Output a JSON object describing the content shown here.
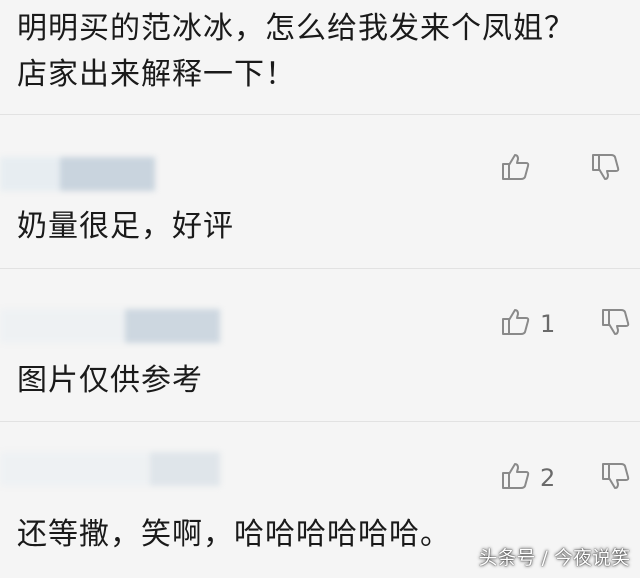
{
  "comments": [
    {
      "text_lines": [
        "明明买的范冰冰，怎么给我发来个凤姐？",
        "店家出来解释一下！"
      ]
    },
    {
      "text": "奶量很足，好评",
      "likes": ""
    },
    {
      "text": "图片仅供参考",
      "likes": "1"
    },
    {
      "text": "还等撒，笑啊，哈哈哈哈哈哈。",
      "likes": "2"
    }
  ],
  "watermark": "头条号 / 今夜说笑",
  "icons": {
    "like": "thumbs-up-outline-icon",
    "dislike": "thumbs-down-outline-icon"
  },
  "colors": {
    "background": "#f5f5f5",
    "text": "#1a1a1a",
    "icon": "#8a8a8a",
    "divider": "#e2e2e2"
  }
}
